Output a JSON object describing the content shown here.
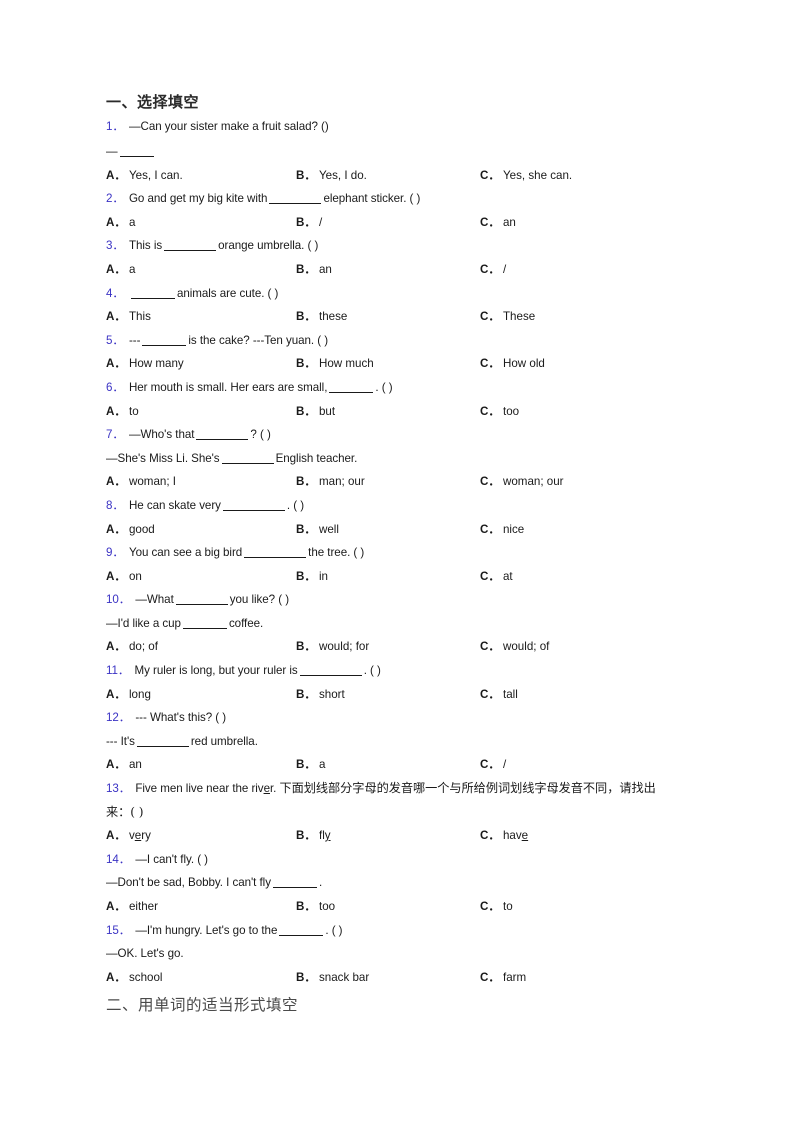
{
  "document": {
    "sections": [
      {
        "id": "section-1",
        "heading": "一、选择填空"
      },
      {
        "id": "section-2",
        "heading": "二、用单词的适当形式填空"
      }
    ],
    "questions": [
      {
        "number": "1．",
        "stem_before": "—Can your sister make a fruit salad? (",
        "stem_after": ")",
        "extra_line": "—",
        "options": [
          {
            "letter": "A．",
            "text": "Yes, I can."
          },
          {
            "letter": "B．",
            "text": "Yes, I do."
          },
          {
            "letter": "C．",
            "text": "Yes, she can."
          }
        ]
      },
      {
        "number": "2．",
        "stem_before": "Go and get my big kite with",
        "stem_after": "elephant sticker. (   )",
        "options": [
          {
            "letter": "A．",
            "text": "a"
          },
          {
            "letter": "B．",
            "text": "/"
          },
          {
            "letter": "C．",
            "text": "an"
          }
        ]
      },
      {
        "number": "3．",
        "stem_before": "This is",
        "stem_after": "orange umbrella. (  )",
        "options": [
          {
            "letter": "A．",
            "text": "a"
          },
          {
            "letter": "B．",
            "text": "an"
          },
          {
            "letter": "C．",
            "text": "/"
          }
        ]
      },
      {
        "number": "4．",
        "stem_before": "",
        "stem_after": "animals are cute. (  )",
        "options": [
          {
            "letter": "A．",
            "text": "This"
          },
          {
            "letter": "B．",
            "text": "these"
          },
          {
            "letter": "C．",
            "text": "These"
          }
        ]
      },
      {
        "number": "5．",
        "stem_before": "---",
        "stem_after": "is the cake? ---Ten yuan. (  )",
        "options": [
          {
            "letter": "A．",
            "text": "How many"
          },
          {
            "letter": "B．",
            "text": "How much"
          },
          {
            "letter": "C．",
            "text": "How old"
          }
        ]
      },
      {
        "number": "6．",
        "stem_before": "Her mouth is small. Her ears are small,",
        "stem_after": ". (  )",
        "options": [
          {
            "letter": "A．",
            "text": "to"
          },
          {
            "letter": "B．",
            "text": "but"
          },
          {
            "letter": "C．",
            "text": "too"
          }
        ]
      },
      {
        "number": "7．",
        "stem_before": "—Who's that",
        "stem_after": "? (  )",
        "sub_before": "—She's Miss Li. She's",
        "sub_after": "English teacher.",
        "options": [
          {
            "letter": "A．",
            "text": "woman; I"
          },
          {
            "letter": "B．",
            "text": "man; our"
          },
          {
            "letter": "C．",
            "text": "woman; our"
          }
        ]
      },
      {
        "number": "8．",
        "stem_before": "He can skate very",
        "stem_after": ". (    )",
        "options": [
          {
            "letter": "A．",
            "text": "good"
          },
          {
            "letter": "B．",
            "text": "well"
          },
          {
            "letter": "C．",
            "text": "nice"
          }
        ]
      },
      {
        "number": "9．",
        "stem_before": "You can see a big bird",
        "stem_after": "the tree. (  )",
        "options": [
          {
            "letter": "A．",
            "text": "on"
          },
          {
            "letter": "B．",
            "text": "in"
          },
          {
            "letter": "C．",
            "text": "at"
          }
        ]
      },
      {
        "number": "10．",
        "stem_before": "—What",
        "stem_after": "you like? (  )",
        "sub_before": "—I'd like a cup",
        "sub_after": "coffee.",
        "options": [
          {
            "letter": "A．",
            "text": "do; of"
          },
          {
            "letter": "B．",
            "text": "would; for"
          },
          {
            "letter": "C．",
            "text": "would; of"
          }
        ]
      },
      {
        "number": "11．",
        "stem_before": "My ruler is long, but your ruler is",
        "stem_after": ". (  )",
        "options": [
          {
            "letter": "A．",
            "text": "long"
          },
          {
            "letter": "B．",
            "text": "short"
          },
          {
            "letter": "C．",
            "text": "tall"
          }
        ]
      },
      {
        "number": "12．",
        "stem_before": "--- What's this? (  )",
        "stem_after": "",
        "sub_before": "--- It's",
        "sub_after": "red umbrella.",
        "options": [
          {
            "letter": "A．",
            "text": "an"
          },
          {
            "letter": "B．",
            "text": "a"
          },
          {
            "letter": "C．",
            "text": "/"
          }
        ]
      },
      {
        "number": "13．",
        "stem_text_1": "Five men live near the riv",
        "stem_underline_1": "e",
        "stem_text_2": "r. ",
        "stem_cn": "下面划线部分字母的发音哪一个与所给例词划线字母发音不同，请找出来：(  )",
        "options": [
          {
            "letter": "A．",
            "pre": "v",
            "ul": "e",
            "post": "ry"
          },
          {
            "letter": "B．",
            "pre": "fl",
            "ul": "y",
            "post": ""
          },
          {
            "letter": "C．",
            "pre": "hav",
            "ul": "e",
            "post": ""
          }
        ]
      },
      {
        "number": "14．",
        "stem_before": "—I can't fly. (  )",
        "stem_after": "",
        "sub_before": "—Don't be sad, Bobby. I can't fly",
        "sub_after": ".",
        "options": [
          {
            "letter": "A．",
            "text": "either"
          },
          {
            "letter": "B．",
            "text": "too"
          },
          {
            "letter": "C．",
            "text": "to"
          }
        ]
      },
      {
        "number": "15．",
        "stem_before": "—I'm hungry. Let's go to the",
        "stem_after": ". (  )",
        "sub_before": "—OK. Let's go.",
        "sub_after": "",
        "options": [
          {
            "letter": "A．",
            "text": "school"
          },
          {
            "letter": "B．",
            "text": "snack bar"
          },
          {
            "letter": "C．",
            "text": "farm"
          }
        ]
      }
    ]
  },
  "colors": {
    "question_number": "#3b33c4",
    "body_text": "#1a1a1a",
    "page_background": "#ffffff"
  }
}
